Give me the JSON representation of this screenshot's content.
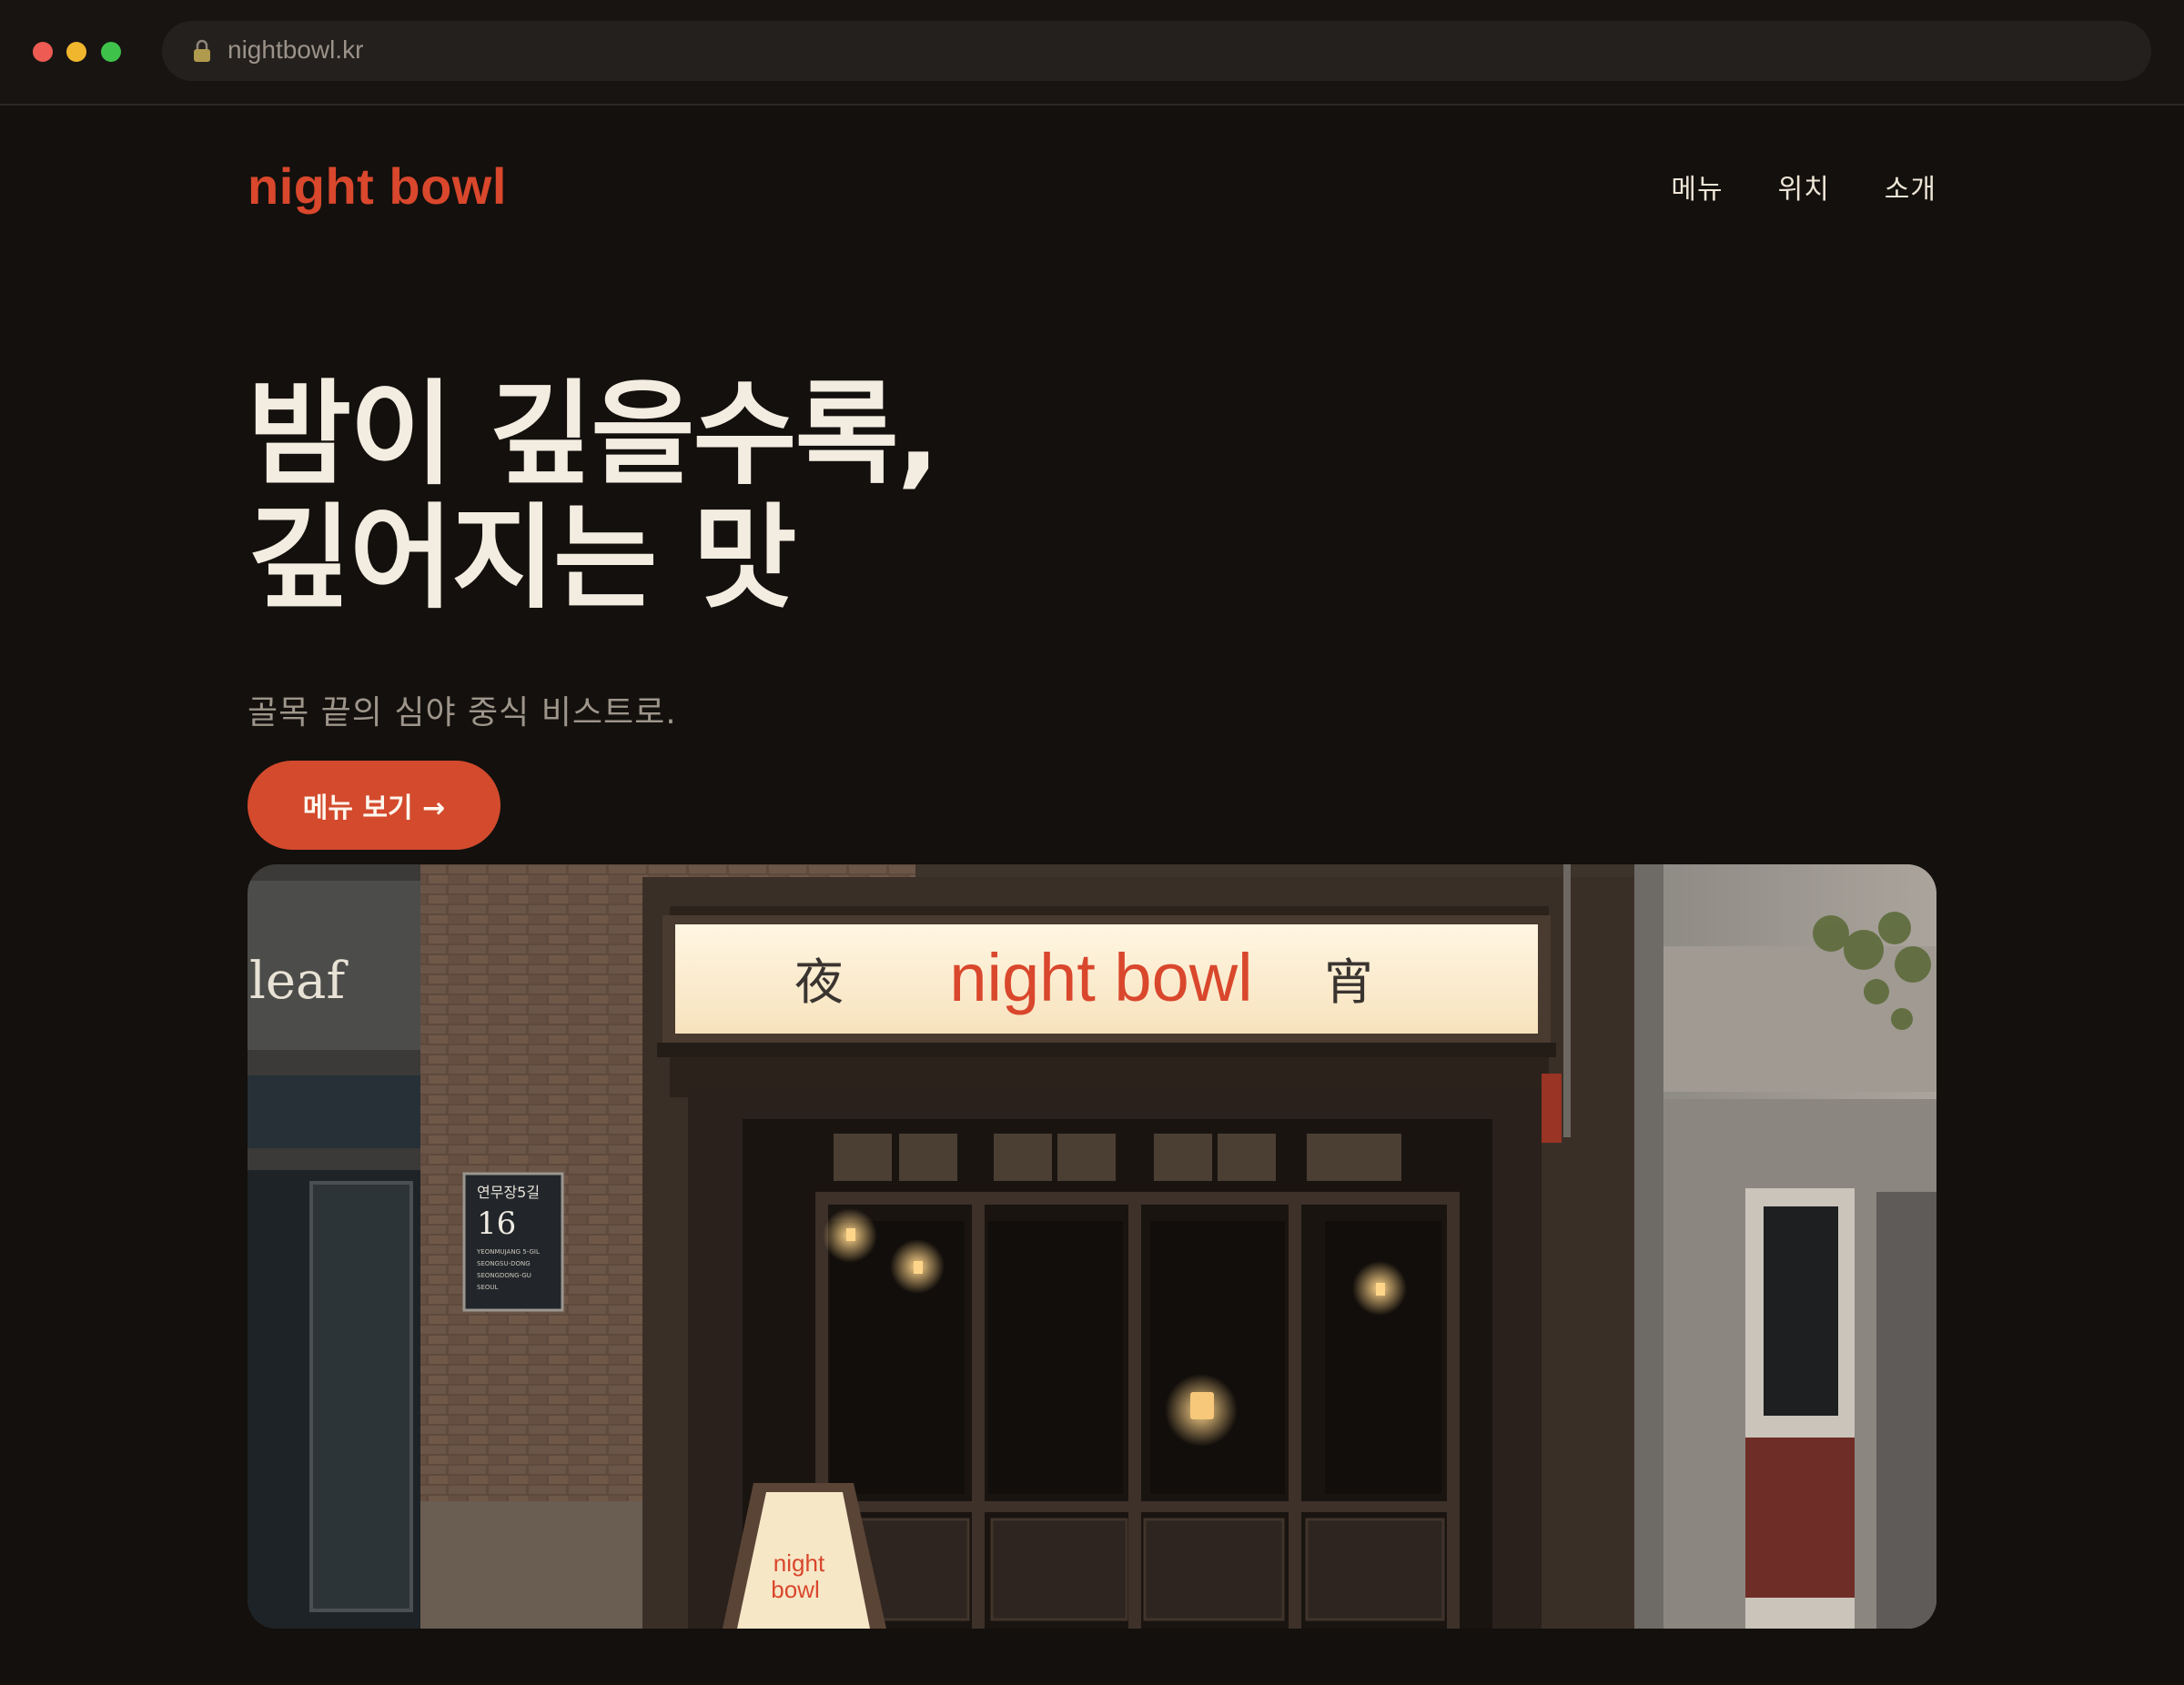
{
  "browser": {
    "url": "nightbowl.kr"
  },
  "header": {
    "logo": "night bowl",
    "nav": [
      "메뉴",
      "위치",
      "소개"
    ]
  },
  "hero": {
    "title_line1": "밤이 깊을수록,",
    "title_line2": "깊어지는 맛",
    "subtitle": "골목 끝의 심야 중식 비스트로.",
    "cta_label": "메뉴 보기 →"
  },
  "storefront": {
    "sign_left_char": "夜",
    "sign_text": "night bowl",
    "sign_right_char": "宵",
    "neighbor_sign": "leaf",
    "address_plate": {
      "street": "연무장5길",
      "number": "16",
      "line1": "YEONMUJANG 5-GIL",
      "line2": "SEONGSU-DONG",
      "line3": "SEONGDONG-GU",
      "line4": "SEOUL"
    },
    "aboard_line1": "night",
    "aboard_line2": "bowl"
  },
  "colors": {
    "background": "#13100d",
    "accent": "#d9472c",
    "text": "#efe6d8",
    "muted": "#9e958b"
  }
}
